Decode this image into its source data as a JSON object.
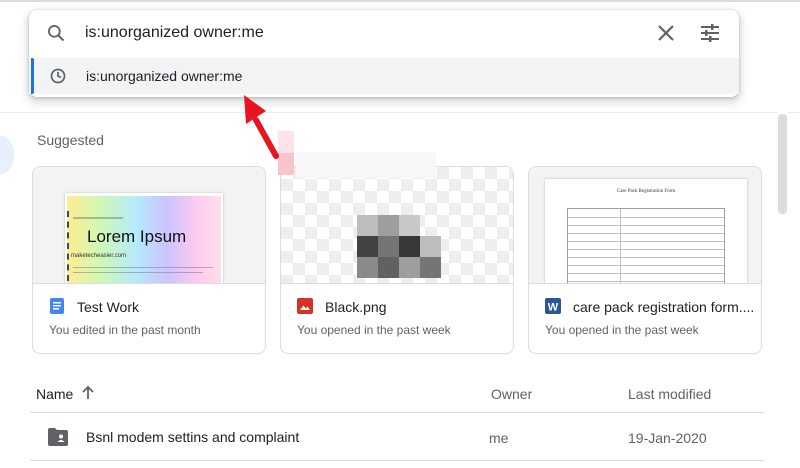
{
  "search": {
    "query": "is:unorganized owner:me",
    "suggestion": "is:unorganized owner:me"
  },
  "suggested": {
    "title": "Suggested",
    "cards": [
      {
        "name": "Test Work",
        "subtitle": "You edited in the past month",
        "icon": "google-docs-icon",
        "thumb_text": "Lorem Ipsum",
        "thumb_site": "maketecheasier.com"
      },
      {
        "name": "Black.png",
        "subtitle": "You opened in the past week",
        "icon": "image-file-icon"
      },
      {
        "name": "care pack registration form....",
        "subtitle": "You opened in the past week",
        "icon": "word-file-icon",
        "thumb_title": "Care Pack Registration Form"
      }
    ]
  },
  "list": {
    "headers": {
      "name": "Name",
      "owner": "Owner",
      "modified": "Last modified"
    },
    "rows": [
      {
        "name": "Bsnl modem settins and complaint",
        "owner": "me",
        "modified": "19-Jan-2020",
        "icon": "shared-folder-icon"
      }
    ]
  },
  "colors": {
    "accent": "#1a73e8",
    "annotation_arrow": "#e8141f",
    "docs_blue": "#4285f4",
    "image_red": "#d93025",
    "word_blue": "#2b579a"
  }
}
